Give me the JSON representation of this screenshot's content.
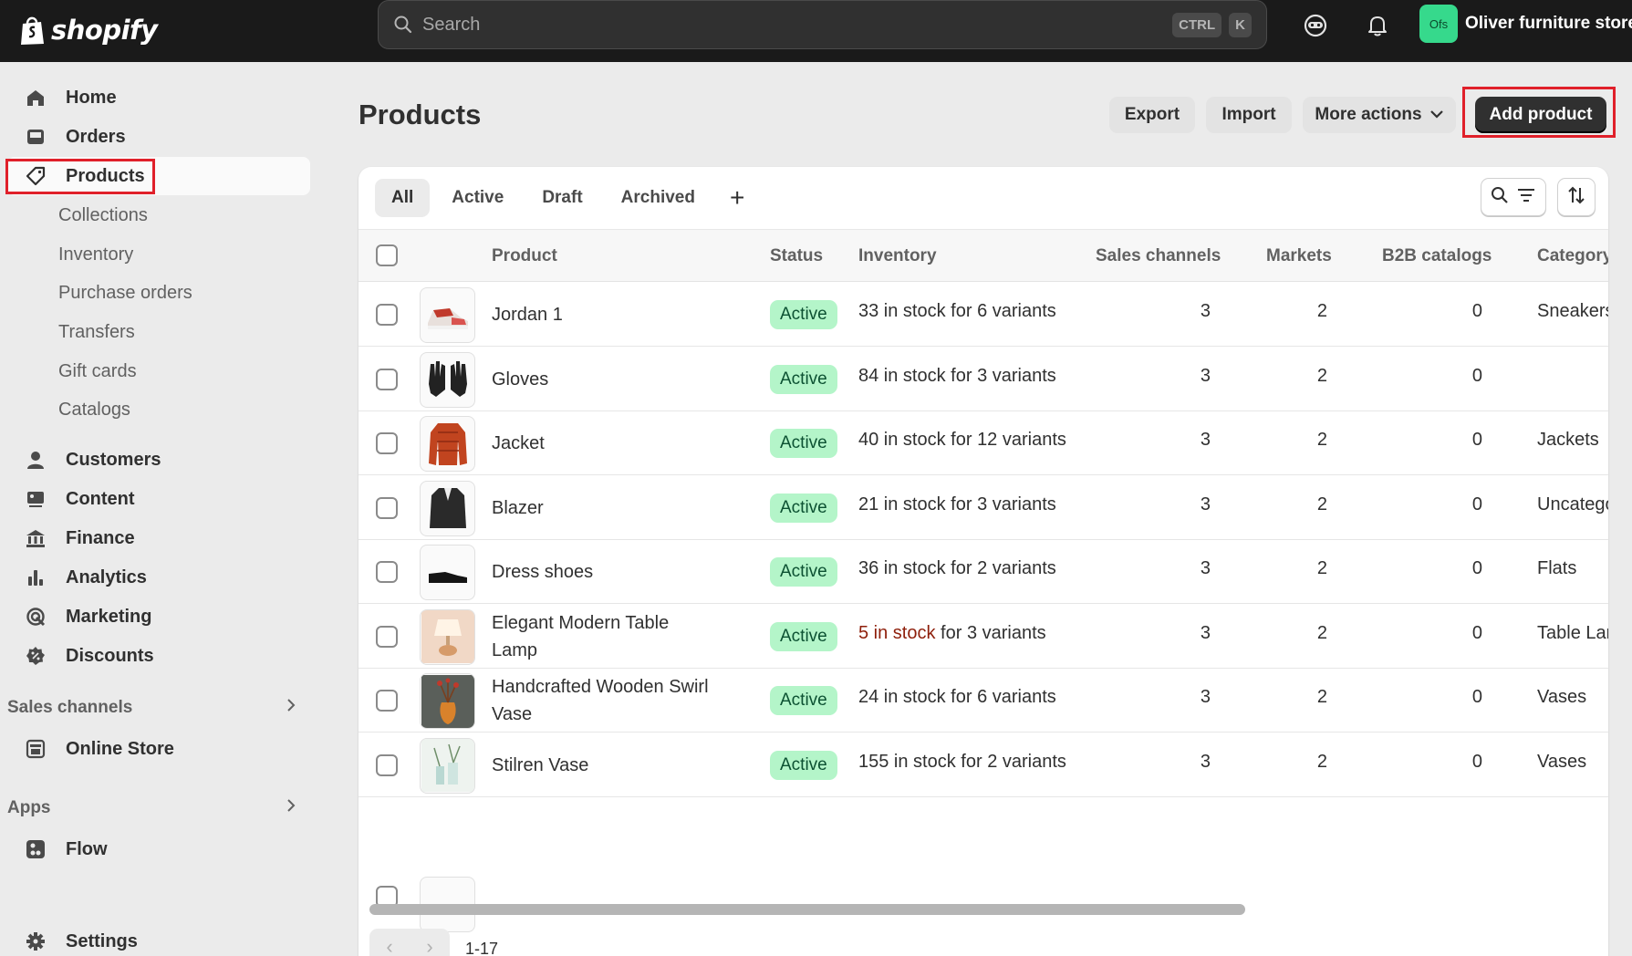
{
  "brand": {
    "name": "shopify"
  },
  "search": {
    "placeholder": "Search",
    "shortcut_1": "CTRL",
    "shortcut_2": "K"
  },
  "store": {
    "initials": "Ofs",
    "name": "Oliver furniture store"
  },
  "nav": {
    "home": "Home",
    "orders": "Orders",
    "products": "Products",
    "sub": [
      "Collections",
      "Inventory",
      "Purchase orders",
      "Transfers",
      "Gift cards",
      "Catalogs"
    ],
    "customers": "Customers",
    "content": "Content",
    "finance": "Finance",
    "analytics": "Analytics",
    "marketing": "Marketing",
    "discounts": "Discounts",
    "sales_channels": "Sales channels",
    "online_store": "Online Store",
    "apps": "Apps",
    "flow": "Flow",
    "settings": "Settings"
  },
  "page": {
    "title": "Products",
    "export": "Export",
    "import": "Import",
    "more_actions": "More actions",
    "add_product": "Add product"
  },
  "tabs": [
    "All",
    "Active",
    "Draft",
    "Archived",
    "+"
  ],
  "columns": {
    "product": "Product",
    "status": "Status",
    "inventory": "Inventory",
    "sales_channels": "Sales channels",
    "markets": "Markets",
    "b2b": "B2B catalogs",
    "category": "Category"
  },
  "products": [
    {
      "name": "Jordan 1",
      "status": "Active",
      "stock": "33 in stock",
      "variants": " for 6 variants",
      "low": false,
      "channels": "3",
      "markets": "2",
      "b2b": "0",
      "category": "Sneakers"
    },
    {
      "name": "Gloves",
      "status": "Active",
      "stock": "84 in stock",
      "variants": " for 3 variants",
      "low": false,
      "channels": "3",
      "markets": "2",
      "b2b": "0",
      "category": ""
    },
    {
      "name": "Jacket",
      "status": "Active",
      "stock": "40 in stock",
      "variants": " for 12 variants",
      "low": false,
      "channels": "3",
      "markets": "2",
      "b2b": "0",
      "category": "Jackets"
    },
    {
      "name": "Blazer",
      "status": "Active",
      "stock": "21 in stock",
      "variants": " for 3 variants",
      "low": false,
      "channels": "3",
      "markets": "2",
      "b2b": "0",
      "category": "Uncategorized"
    },
    {
      "name": "Dress shoes",
      "status": "Active",
      "stock": "36 in stock",
      "variants": " for 2 variants",
      "low": false,
      "channels": "3",
      "markets": "2",
      "b2b": "0",
      "category": "Flats"
    },
    {
      "name": "Elegant Modern Table Lamp",
      "status": "Active",
      "stock": "5 in stock",
      "variants": " for 3 variants",
      "low": true,
      "channels": "3",
      "markets": "2",
      "b2b": "0",
      "category": "Table Lamps"
    },
    {
      "name": "Handcrafted Wooden Swirl Vase",
      "status": "Active",
      "stock": "24 in stock",
      "variants": " for 6 variants",
      "low": false,
      "channels": "3",
      "markets": "2",
      "b2b": "0",
      "category": "Vases"
    },
    {
      "name": "Stilren Vase",
      "status": "Active",
      "stock": "155 in stock",
      "variants": " for 2 variants",
      "low": false,
      "channels": "3",
      "markets": "2",
      "b2b": "0",
      "category": "Vases"
    }
  ],
  "pagination": {
    "range": "1-17"
  }
}
